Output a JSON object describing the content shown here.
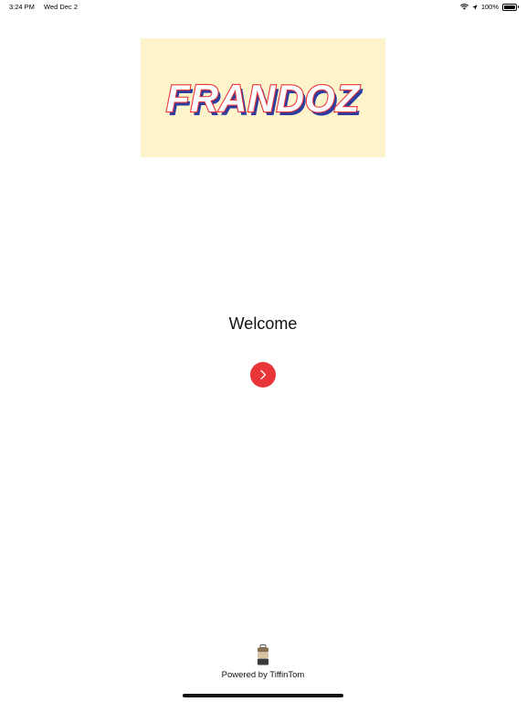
{
  "status": {
    "time": "3:24 PM",
    "date": "Wed Dec 2",
    "battery_percent": "100%",
    "battery_level": 1.0
  },
  "banner": {
    "logo_text": "FRANDOZ"
  },
  "main": {
    "welcome_text": "Welcome"
  },
  "footer": {
    "powered_by": "Powered by TiffinTom"
  },
  "colors": {
    "accent": "#e8363a",
    "banner_bg": "#fef4cc",
    "logo_shadow": "#2b3d9e"
  },
  "icons": {
    "next": "chevron-right-icon",
    "brand": "tiffin-box-icon"
  }
}
